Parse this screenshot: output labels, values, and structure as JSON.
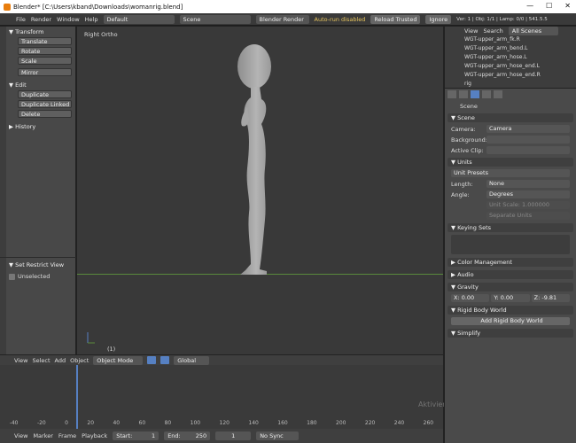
{
  "window": {
    "title": "Blender* [C:\\Users\\kband\\Downloads\\womanrig.blend]",
    "min": "—",
    "max": "☐",
    "close": "✕"
  },
  "menubar": {
    "file": "File",
    "render": "Render",
    "window": "Window",
    "help": "Help",
    "layout": "Default",
    "scene": "Scene",
    "engine": "Blender Render",
    "autorun_warning": "Auto-run disabled",
    "reload_trusted": "Reload Trusted",
    "ignore": "Ignore",
    "stats": "Ver: 1 | Obj: 1/1 | Lamp: 0/0 | 541.5.5"
  },
  "left_panel": {
    "transform_header": "▼ Transform",
    "translate": "Translate",
    "rotate": "Rotate",
    "scale": "Scale",
    "mirror": "Mirror",
    "edit_header": "▼ Edit",
    "duplicate": "Duplicate",
    "duplicate_linked": "Duplicate Linked",
    "delete": "Delete",
    "history_header": "▶ History",
    "restrict_header": "▼ Set Restrict View",
    "unselected": "Unselected"
  },
  "viewport": {
    "view_label": "Right Ortho",
    "frame": "(1)"
  },
  "outliner": {
    "view": "View",
    "search": "Search",
    "scenes": "All Scenes",
    "items": [
      "WGT-upper_arm_fk.R",
      "WGT-upper_arm_bend.L",
      "WGT-upper_arm_hose.L",
      "WGT-upper_arm_hose_end.L",
      "WGT-upper_arm_hose_end.R",
      "rig"
    ]
  },
  "properties": {
    "scene_label": "Scene",
    "scene_header": "▼ Scene",
    "camera_label": "Camera:",
    "camera_value": "Camera",
    "background_label": "Background:",
    "active_clip_label": "Active Clip:",
    "units_header": "▼ Units",
    "unit_presets": "Unit Presets",
    "length_label": "Length:",
    "length_value": "None",
    "angle_label": "Angle:",
    "angle_value": "Degrees",
    "unit_scale": "Unit Scale: 1.000000",
    "separate_units": "Separate Units",
    "keying_header": "▼ Keying Sets",
    "color_mgmt": "▶ Color Management",
    "audio": "▶ Audio",
    "gravity": "▼ Gravity",
    "gravity_x": "X: 0.00",
    "gravity_y": "Y: 0.00",
    "gravity_z": "Z: -9.81",
    "rigid_body_world": "▼ Rigid Body World",
    "add_rigid_body_world": "Add Rigid Body World",
    "simplify": "▼ Simplify"
  },
  "viewport_header": {
    "view": "View",
    "select": "Select",
    "add": "Add",
    "object": "Object",
    "mode": "Object Mode",
    "orientation": "Global"
  },
  "timeline_ticks": [
    "-40",
    "-20",
    "0",
    "20",
    "40",
    "60",
    "80",
    "100",
    "120",
    "140",
    "160",
    "180",
    "200",
    "220",
    "240",
    "260"
  ],
  "footer": {
    "view": "View",
    "marker": "Marker",
    "frame": "Frame",
    "playback": "Playback",
    "start": "Start:",
    "start_value": "1",
    "end": "End:",
    "end_value": "250",
    "current": "1",
    "sync": "No Sync"
  },
  "watermark": "Aktivieren Sie Windows",
  "colors": {
    "viewport_bg": "#393939",
    "panel_bg": "#484848",
    "accent_blue": "#5680c2",
    "ground_line": "#5a8a3c"
  }
}
